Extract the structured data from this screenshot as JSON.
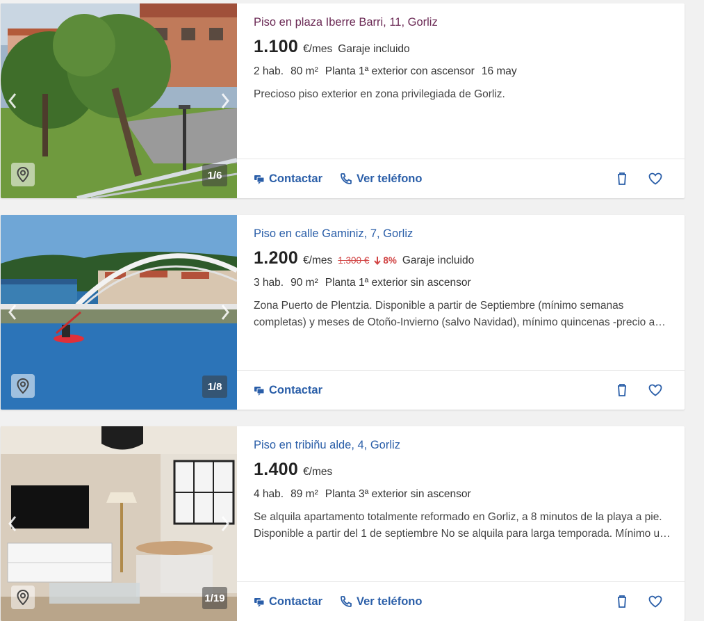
{
  "colors": {
    "link": "#2a5ea8",
    "visited_link": "#6b2a55",
    "price_drop": "#d14343",
    "page_bg": "#f1f1f1"
  },
  "icons": {
    "prev": "chevron-left-icon",
    "next": "chevron-right-icon",
    "map": "map-pin-icon",
    "contact": "chat-icon",
    "phone": "phone-icon",
    "discard": "trash-icon",
    "favorite": "heart-icon"
  },
  "listings": [
    {
      "title": "Piso en plaza Iberre Barri, 11, Gorliz",
      "visited": true,
      "price": "1.100",
      "price_unit": "€/mes",
      "old_price": "",
      "drop": "",
      "extra": "Garaje incluido",
      "details": [
        "2 hab.",
        "80 m²",
        "Planta 1ª exterior con ascensor",
        "16 may"
      ],
      "description": "Precioso piso exterior en zona privilegiada de Gorliz.",
      "photo_counter": "1/6",
      "contact_label": "Contactar",
      "phone_label": "Ver teléfono"
    },
    {
      "title": "Piso en calle Gaminiz, 7, Gorliz",
      "visited": false,
      "price": "1.200",
      "price_unit": "€/mes",
      "old_price": "1.300 €",
      "drop": "8%",
      "extra": "Garaje incluido",
      "details": [
        "3 hab.",
        "90 m²",
        "Planta 1ª exterior sin ascensor"
      ],
      "description": "Zona Puerto de Plentzia. Disponible a partir de Septiembre (mínimo semanas completas) y meses de Otoño-Invierno (salvo Navidad), mínimo quincenas -precio a consultar.",
      "photo_counter": "1/8",
      "contact_label": "Contactar",
      "phone_label": ""
    },
    {
      "title": "Piso en tribiñu alde, 4, Gorliz",
      "visited": false,
      "price": "1.400",
      "price_unit": "€/mes",
      "old_price": "",
      "drop": "",
      "extra": "",
      "details": [
        "4 hab.",
        "89 m²",
        "Planta 3ª exterior sin ascensor"
      ],
      "description": "Se alquila apartamento totalmente reformado en Gorliz, a 8 minutos de la playa a pie. Disponible a partir del 1 de septiembre No se alquila para larga temporada. Mínimo un mes.",
      "photo_counter": "1/19",
      "contact_label": "Contactar",
      "phone_label": "Ver teléfono"
    }
  ]
}
